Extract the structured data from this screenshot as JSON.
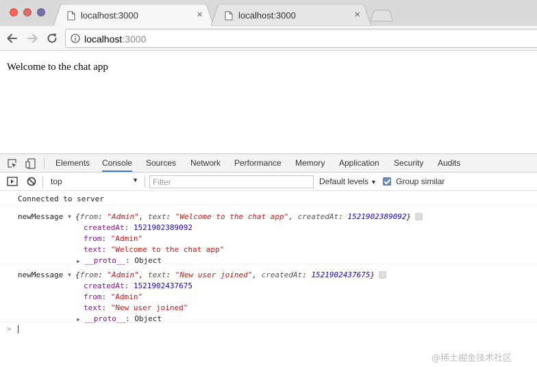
{
  "browser": {
    "tabs": [
      {
        "title": "localhost:3000",
        "close": "×",
        "active": true
      },
      {
        "title": "localhost:3000",
        "close": "×",
        "active": false
      }
    ],
    "url_host": "localhost",
    "url_port": ":3000"
  },
  "page": {
    "text": "Welcome to the chat app"
  },
  "devtools": {
    "tabs": [
      "Elements",
      "Console",
      "Sources",
      "Network",
      "Performance",
      "Memory",
      "Application",
      "Security",
      "Audits"
    ],
    "active_tab": "Console",
    "context": "top",
    "filter_placeholder": "Filter",
    "levels": "Default levels",
    "group_similar": "Group similar",
    "group_similar_checked": true
  },
  "console": {
    "connected": "Connected to server",
    "messages": [
      {
        "label": "newMessage",
        "from": "\"Admin\"",
        "text": "\"Welcome to the chat app\"",
        "createdAt": "1521902389092"
      },
      {
        "label": "newMessage",
        "from": "\"Admin\"",
        "text": "\"New user joined\"",
        "createdAt": "1521902437675"
      }
    ],
    "proto_key": "__proto__",
    "proto_value": "Object",
    "prompt": ">"
  },
  "watermark": "@稀土掘金技术社区",
  "colors": {
    "active_tab_underline": "#3879d9",
    "string": "#c41a16",
    "number": "#1c00cf",
    "property_key": "#881391"
  }
}
